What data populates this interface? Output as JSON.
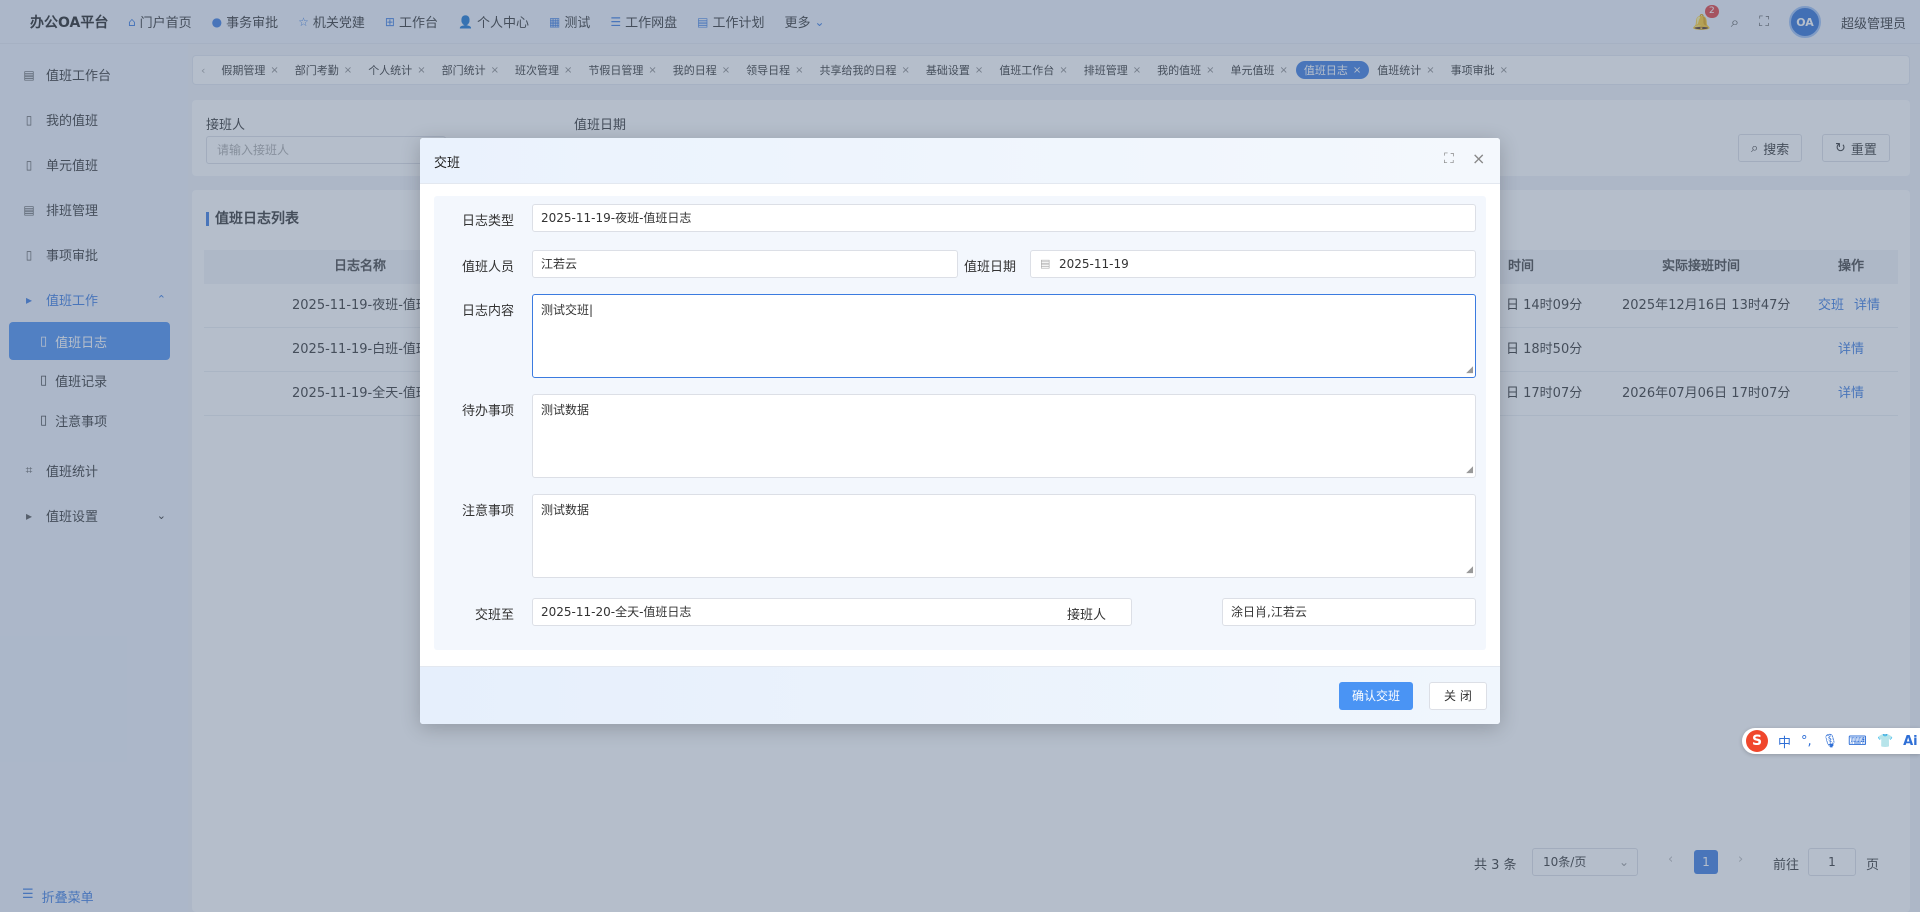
{
  "app": {
    "brand": "办公OA平台",
    "notifications": "2",
    "avatar_text": "OA",
    "user": "超级管理员"
  },
  "topnav": [
    {
      "label": "门户首页",
      "icon": "home-icon"
    },
    {
      "label": "事务审批",
      "icon": "info-icon"
    },
    {
      "label": "机关党建",
      "icon": "star-icon"
    },
    {
      "label": "工作台",
      "icon": "sitemap-icon"
    },
    {
      "label": "个人中心",
      "icon": "user-icon"
    },
    {
      "label": "测试",
      "icon": "grid-icon"
    },
    {
      "label": "工作网盘",
      "icon": "database-icon"
    },
    {
      "label": "工作计划",
      "icon": "calendar-icon"
    },
    {
      "label": "更多",
      "icon": "chevron-down-icon"
    }
  ],
  "sidebar": {
    "items": [
      "值班工作台",
      "我的值班",
      "单元值班",
      "排班管理",
      "事项审批"
    ],
    "group_open": "值班工作",
    "sub_items": [
      "值班日志",
      "值班记录",
      "注意事项"
    ],
    "items_after": [
      "值班统计"
    ],
    "group_closed": "值班设置",
    "collapse": "折叠菜单"
  },
  "tabs": [
    "假期管理",
    "部门考勤",
    "个人统计",
    "部门统计",
    "班次管理",
    "节假日管理",
    "我的日程",
    "领导日程",
    "共享给我的日程",
    "基础设置",
    "值班工作台",
    "排班管理",
    "我的值班",
    "单元值班",
    "值班日志",
    "值班统计",
    "事项审批"
  ],
  "active_tab": "值班日志",
  "search": {
    "label_receiver": "接班人",
    "placeholder_receiver": "请输入接班人",
    "label_date": "值班日期",
    "search_btn": "搜索",
    "reset_btn": "重置"
  },
  "table": {
    "title": "值班日志列表",
    "headers": {
      "name": "日志名称",
      "time": "时间",
      "actual": "实际接班时间",
      "ops": "操作"
    },
    "rows": [
      {
        "name": "2025-11-19-夜班-值班日",
        "time": "日 14时09分",
        "actual": "2025年12月16日 13时47分",
        "op1": "交班",
        "op2": "详情"
      },
      {
        "name": "2025-11-19-白班-值班日",
        "time": "日 18时50分",
        "actual": "",
        "op1": "",
        "op2": "详情"
      },
      {
        "name": "2025-11-19-全天-值班日",
        "time": "日 17时07分",
        "actual": "2026年07月06日 17时07分",
        "op1": "",
        "op2": "详情"
      }
    ]
  },
  "pager": {
    "total": "共 3 条",
    "page_size": "10条/页",
    "current": "1",
    "goto_label": "前往",
    "goto_value": "1",
    "page_suffix": "页"
  },
  "modal": {
    "title": "交班",
    "log_type_label": "日志类型",
    "log_type_value": "2025-11-19-夜班-值班日志",
    "duty_person_label": "值班人员",
    "duty_person_value": "江若云",
    "duty_date_label": "值班日期",
    "duty_date_value": "2025-11-19",
    "content_label": "日志内容",
    "content_value": "测试交班",
    "todo_label": "待办事项",
    "todo_value": "测试数据",
    "notes_label": "注意事项",
    "notes_value": "测试数据",
    "handover_to_label": "交班至",
    "handover_to_value": "2025-11-20-全天-值班日志",
    "receiver_label": "接班人",
    "receiver_value": "涂日肖,江若云",
    "confirm_btn": "确认交班",
    "close_btn": "关 闭"
  },
  "ime": {
    "lang": "中",
    "ai": "Ai"
  }
}
